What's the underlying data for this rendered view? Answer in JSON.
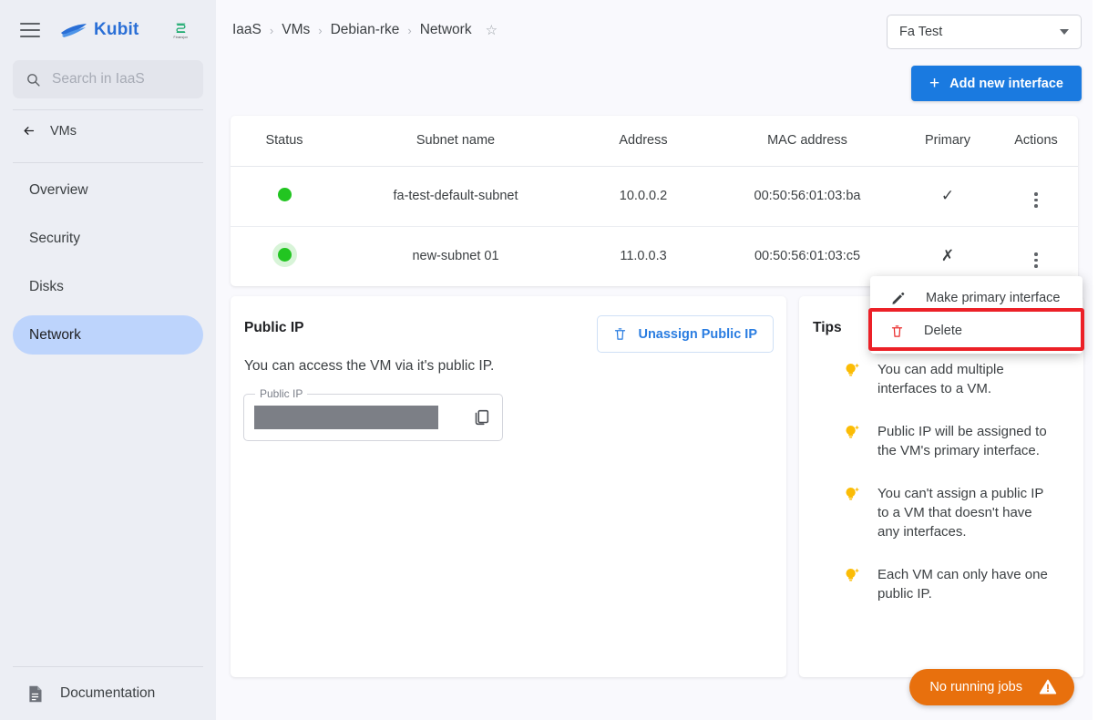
{
  "sidebar": {
    "brand": "Kubit",
    "secondary_logo_sub": "Finansjon",
    "search_placeholder": "Search in IaaS",
    "back_label": "VMs",
    "items": [
      {
        "label": "Overview",
        "active": false
      },
      {
        "label": "Security",
        "active": false
      },
      {
        "label": "Disks",
        "active": false
      },
      {
        "label": "Network",
        "active": true
      }
    ],
    "documentation_label": "Documentation"
  },
  "header": {
    "breadcrumbs": [
      "IaaS",
      "VMs",
      "Debian-rke",
      "Network"
    ],
    "breadcrumb_separator": "›",
    "favorite_icon": "star-icon",
    "project_select_value": "Fa Test",
    "add_button_label": "Add new interface",
    "add_button_color": "#1a7ae0"
  },
  "table": {
    "columns": [
      "Status",
      "Subnet name",
      "Address",
      "MAC address",
      "Primary",
      "Actions"
    ],
    "rows": [
      {
        "status": "running",
        "subnet": "fa-test-default-subnet",
        "address": "10.0.0.2",
        "mac": "00:50:56:01:03:ba",
        "primary": "✓",
        "actions": "kebab-icon"
      },
      {
        "status": "running",
        "subnet": "new-subnet 01",
        "address": "11.0.0.3",
        "mac": "00:50:56:01:03:c5",
        "primary": "✗",
        "actions": "kebab-icon"
      }
    ],
    "status_color": "#22c521"
  },
  "context_menu": {
    "items": [
      {
        "label": "Make primary interface",
        "icon": "pencil-icon",
        "highlighted": false
      },
      {
        "label": "Delete",
        "icon": "trash-icon",
        "highlighted": true
      }
    ],
    "highlight_color": "#ec2027"
  },
  "public_ip": {
    "title": "Public IP",
    "unassign_label": "Unassign Public IP",
    "description": "You can access the VM via it's public IP.",
    "field_label": "Public IP",
    "field_value": "",
    "copy_icon": "copy-icon"
  },
  "tips": {
    "title": "Tips",
    "items": [
      "You can add multiple interfaces to a VM.",
      "Public IP will be assigned to the VM's primary interface.",
      "You can't assign a public IP to a VM that doesn't have any interfaces.",
      "Each VM can only have one public IP."
    ]
  },
  "jobs": {
    "label": "No running jobs",
    "icon": "warning-icon",
    "color": "#e8700d"
  }
}
